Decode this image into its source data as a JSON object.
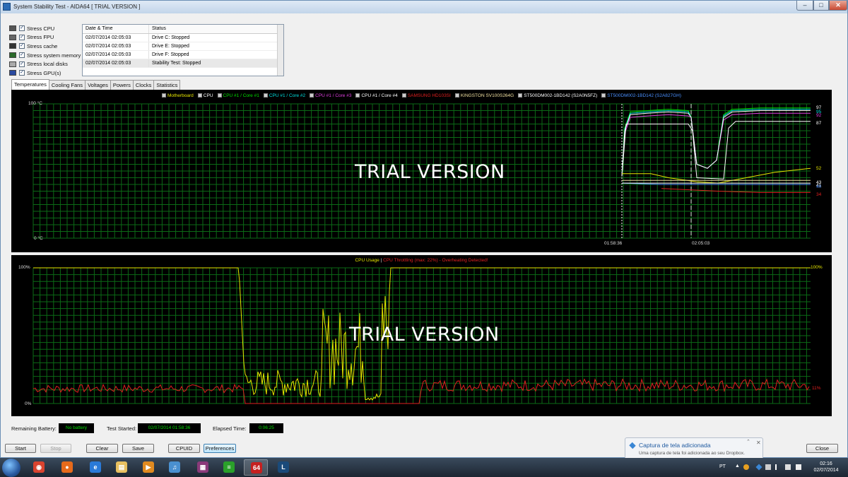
{
  "window": {
    "title": "System Stability Test - AIDA64  [ TRIAL VERSION ]",
    "min": "–",
    "max": "□",
    "close": "✕"
  },
  "stress_items": [
    {
      "label": "Stress CPU",
      "icon": "cpu-icon",
      "color": "#555"
    },
    {
      "label": "Stress FPU",
      "icon": "fpu-icon",
      "color": "#666"
    },
    {
      "label": "Stress cache",
      "icon": "cache-icon",
      "color": "#333"
    },
    {
      "label": "Stress system memory",
      "icon": "memory-icon",
      "color": "#2a6a2a"
    },
    {
      "label": "Stress local disks",
      "icon": "disk-icon",
      "color": "#aaa"
    },
    {
      "label": "Stress GPU(s)",
      "icon": "gpu-icon",
      "color": "#2a4aa0"
    }
  ],
  "log": {
    "columns": [
      "Date & Time",
      "Status"
    ],
    "rows": [
      [
        "02/07/2014 02:05:03",
        "Drive C: Stopped"
      ],
      [
        "02/07/2014 02:05:03",
        "Drive E: Stopped"
      ],
      [
        "02/07/2014 02:05:03",
        "Drive F: Stopped"
      ],
      [
        "02/07/2014 02:05:03",
        "Stability Test: Stopped"
      ]
    ]
  },
  "tabs": [
    "Temperatures",
    "Cooling Fans",
    "Voltages",
    "Powers",
    "Clocks",
    "Statistics"
  ],
  "temp_chart": {
    "legend": [
      {
        "name": "Motherboard",
        "color": "#e6e600"
      },
      {
        "name": "CPU",
        "color": "#ffffff"
      },
      {
        "name": "CPU #1 / Core #1",
        "color": "#00e000"
      },
      {
        "name": "CPU #1 / Core #2",
        "color": "#00e0e0"
      },
      {
        "name": "CPU #1 / Core #3",
        "color": "#e040e0"
      },
      {
        "name": "CPU #1 / Core #4",
        "color": "#ffffff"
      },
      {
        "name": "SAMSUNG HD103SI",
        "color": "#e02020"
      },
      {
        "name": "KINGSTON SV100S264G",
        "color": "#f0e0a0"
      },
      {
        "name": "ST500DM002-1BD142 (S2A0N5FZ)",
        "color": "#ffffff"
      },
      {
        "name": "ST500DM002-1BD142 (S2A827GH)",
        "color": "#4a90ff"
      }
    ],
    "y_top": "100 °C",
    "y_bottom": "0 °C",
    "time_labels": [
      "01:58:36",
      "02:05:03"
    ],
    "end_values": [
      {
        "text": "97",
        "color": "#ffffff"
      },
      {
        "text": "95",
        "color": "#00e0e0"
      },
      {
        "text": "92",
        "color": "#e040e0"
      },
      {
        "text": "87",
        "color": "#ffffff"
      },
      {
        "text": "52",
        "color": "#e6e600"
      },
      {
        "text": "43",
        "color": "#ffffff"
      },
      {
        "text": "41",
        "color": "#ffffff"
      },
      {
        "text": "40",
        "color": "#4a90ff"
      },
      {
        "text": "34",
        "color": "#e02020"
      }
    ],
    "watermark": "TRIAL VERSION"
  },
  "cpu_chart": {
    "legend_usage": "CPU Usage",
    "legend_sep": "|",
    "legend_throttle": "CPU Throttling (max: 22%) - Overheating Detected!",
    "y_top": "100%",
    "y_bottom": "0%",
    "right_top": "100%",
    "right_bottom": "11%",
    "watermark": "TRIAL VERSION"
  },
  "status": {
    "battery_label": "Remaining Battery:",
    "battery_value": "No battery",
    "started_label": "Test Started:",
    "started_value": "02/07/2014 01:58:36",
    "elapsed_label": "Elapsed Time:",
    "elapsed_value": "0:06:25"
  },
  "buttons": {
    "start": "Start",
    "stop": "Stop",
    "clear": "Clear",
    "save": "Save",
    "cpuid": "CPUID",
    "preferences": "Preferences",
    "close": "Close"
  },
  "notification": {
    "title": "Captura de tela adicionada",
    "body": "Uma captura de tela foi adicionada ao seu Dropbox."
  },
  "taskbar": {
    "apps": [
      {
        "icon": "chrome-icon",
        "glyph": "◉",
        "color": "#d9432f"
      },
      {
        "icon": "firefox-icon",
        "glyph": "●",
        "color": "#e66a1b"
      },
      {
        "icon": "ie-icon",
        "glyph": "e",
        "color": "#2a7ad8"
      },
      {
        "icon": "explorer-icon",
        "glyph": "▤",
        "color": "#e8c060"
      },
      {
        "icon": "media-player-icon",
        "glyph": "▶",
        "color": "#e08a20"
      },
      {
        "icon": "itunes-icon",
        "glyph": "♫",
        "color": "#4a90d0"
      },
      {
        "icon": "winrar-icon",
        "glyph": "▦",
        "color": "#8a3a7a"
      },
      {
        "icon": "monitor-app-icon",
        "glyph": "≡",
        "color": "#2aa02a"
      },
      {
        "icon": "aida64-icon",
        "glyph": "64",
        "color": "#c62020"
      },
      {
        "icon": "league-icon",
        "glyph": "L",
        "color": "#1a4a7a"
      }
    ],
    "lang": "PT",
    "time": "02:16",
    "date": "02/07/2014"
  }
}
